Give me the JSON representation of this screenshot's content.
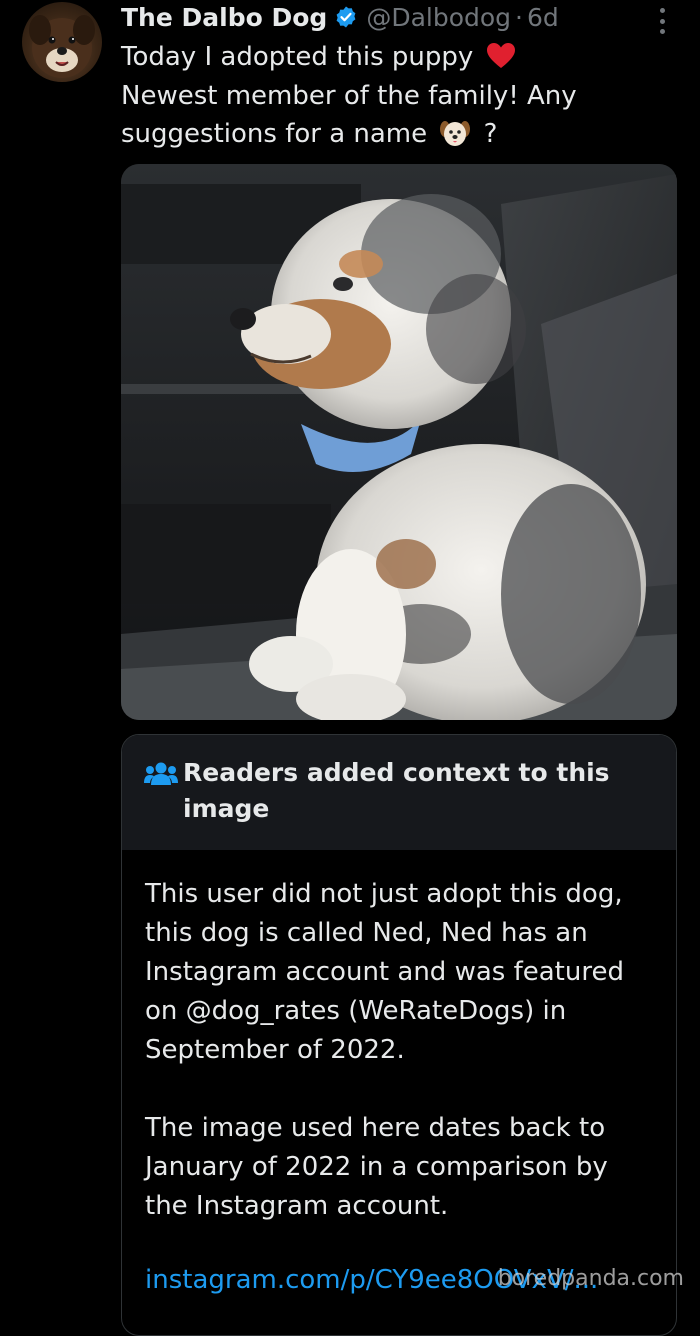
{
  "post": {
    "author_name": "The Dalbo Dog",
    "handle": "@Dalbodog",
    "separator": "·",
    "time": "6d",
    "text_line1": "Today I adopted this puppy",
    "text_line2": "Newest member of the family! Any",
    "text_line3_start": "suggestions for a name",
    "text_line3_end": "?"
  },
  "context_note": {
    "title": "Readers added context to this image",
    "body_lines_p1": [
      "This user did not just adopt this dog,",
      "this dog is called Ned, Ned has an",
      "Instagram account and was featured",
      "on @dog_rates (WeRateDogs) in",
      "September of 2022."
    ],
    "body_lines_p2": [
      "The image used here dates back to",
      "January of 2022 in a comparison by",
      "the Instagram account."
    ],
    "link": "instagram.com/p/CY9ee8OOVxV/..."
  },
  "watermark": "boredpanda.com",
  "icons": {
    "verified": "verified-badge-icon",
    "more": "more-options-icon",
    "heart": "red-heart-emoji",
    "puppy": "dog-face-emoji",
    "readers": "people-icon"
  },
  "colors": {
    "background": "#000000",
    "text": "#e7e9ea",
    "secondary": "#71767b",
    "link": "#1d9bf0",
    "verified": "#1d9bf0",
    "card_header": "#16181c",
    "border": "#2f3336"
  }
}
